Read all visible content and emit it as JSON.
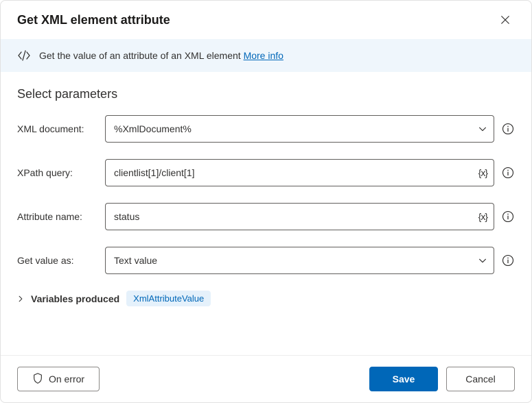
{
  "title": "Get XML element attribute",
  "banner": {
    "text": "Get the value of an attribute of an XML element ",
    "link": "More info"
  },
  "section_title": "Select parameters",
  "fields": {
    "xml_document": {
      "label": "XML document:",
      "value": "%XmlDocument%"
    },
    "xpath_query": {
      "label": "XPath query:",
      "value": "clientlist[1]/client[1]"
    },
    "attribute_name": {
      "label": "Attribute name:",
      "value": "status"
    },
    "get_value_as": {
      "label": "Get value as:",
      "value": "Text value"
    }
  },
  "variables": {
    "label": "Variables produced",
    "chip": "XmlAttributeValue"
  },
  "footer": {
    "on_error": "On error",
    "save": "Save",
    "cancel": "Cancel"
  }
}
